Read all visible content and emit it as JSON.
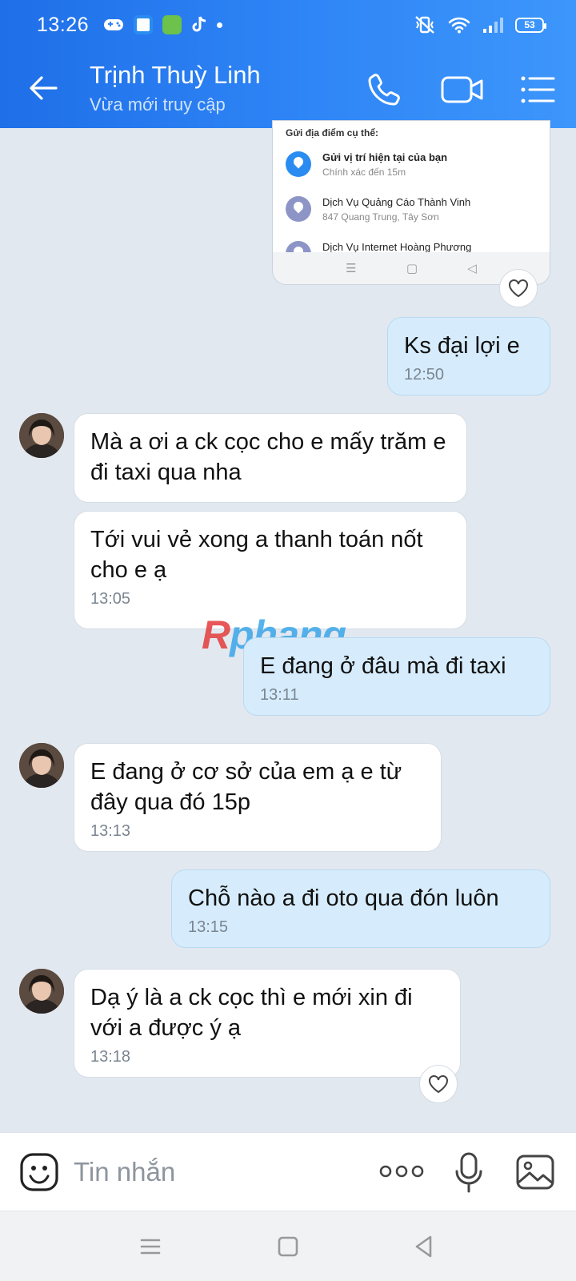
{
  "status_bar": {
    "time": "13:26",
    "battery": "53"
  },
  "header": {
    "contact_name": "Trịnh Thuỳ Linh",
    "contact_status": "Vừa mới truy cập"
  },
  "shared_screenshot": {
    "title": "Gửi địa điểm cụ thể:",
    "options": [
      {
        "label": "Gửi vị trí hiện tại của bạn",
        "sub": "Chính xác đến 15m"
      },
      {
        "label": "Dịch Vụ Quảng Cáo Thành Vinh",
        "sub": "847 Quang Trung, Tây Sơn"
      },
      {
        "label": "Dịch Vụ Internet Hoàng Phương",
        "sub": ""
      }
    ]
  },
  "messages": [
    {
      "dir": "out",
      "text": "Ks đại lợi e",
      "time": "12:50"
    },
    {
      "dir": "in",
      "text": "Mà a ơi a ck cọc cho e mấy trăm e đi taxi qua nha",
      "time": ""
    },
    {
      "dir": "in",
      "text": "Tới vui vẻ xong a thanh toán nốt cho e ạ",
      "time": "13:05"
    },
    {
      "dir": "out",
      "text": "E đang ở đâu mà đi taxi",
      "time": "13:11"
    },
    {
      "dir": "in",
      "text": "E đang ở cơ sở của em ạ e từ đây qua đó 15p",
      "time": "13:13"
    },
    {
      "dir": "out",
      "text": "Chỗ nào a đi oto qua đón luôn",
      "time": "13:15"
    },
    {
      "dir": "in",
      "text": "Dạ ý là a ck cọc thì e mới xin đi với a được ý ạ",
      "time": "13:18"
    }
  ],
  "watermark": {
    "first": "R",
    "rest": "phang"
  },
  "composer": {
    "placeholder": "Tin nhắn"
  },
  "colors": {
    "header": "#2f86f6",
    "outgoing_bubble": "#d6ecfc",
    "incoming_bubble": "#ffffff",
    "background": "#e2e8ef"
  }
}
